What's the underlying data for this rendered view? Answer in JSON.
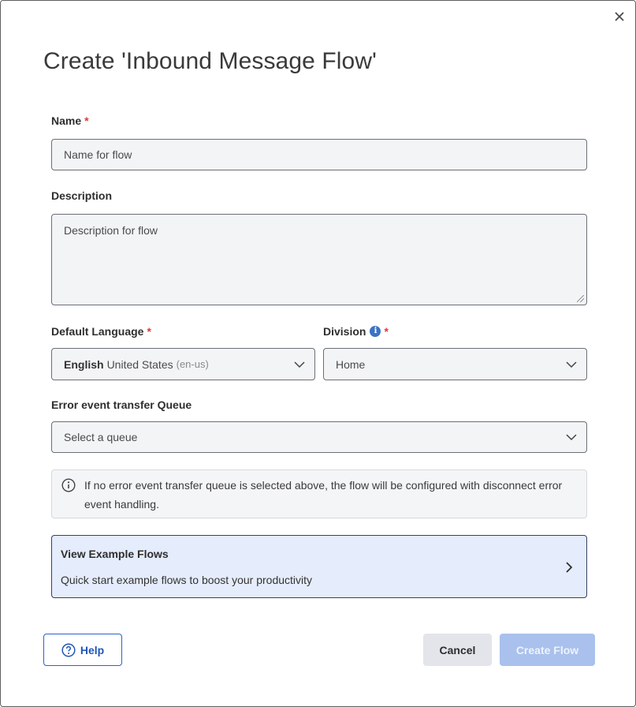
{
  "dialog": {
    "title": "Create 'Inbound Message Flow'",
    "close_icon": "close-icon"
  },
  "form": {
    "name": {
      "label": "Name",
      "required_mark": "*",
      "placeholder": "Name for flow"
    },
    "description": {
      "label": "Description",
      "placeholder": "Description for flow"
    },
    "language": {
      "label": "Default Language",
      "required_mark": "*",
      "selected_bold": "English",
      "selected_rest": "United States",
      "selected_code": "(en-us)"
    },
    "division": {
      "label": "Division",
      "info_icon": "i",
      "required_mark": "*",
      "selected": "Home"
    },
    "queue": {
      "label": "Error event transfer Queue",
      "placeholder": "Select a queue"
    }
  },
  "notice": {
    "text": "If no error event transfer queue is selected above, the flow will be configured with disconnect error event handling."
  },
  "example_flows": {
    "title": "View Example Flows",
    "subtitle": "Quick start example flows to boost your productivity"
  },
  "footer": {
    "help_label": "Help",
    "cancel_label": "Cancel",
    "create_label": "Create Flow"
  },
  "colors": {
    "accent": "#2c63c6",
    "required": "#e0383e",
    "create_disabled": "#a9c1ec",
    "example_bg": "#e5ecfb"
  }
}
